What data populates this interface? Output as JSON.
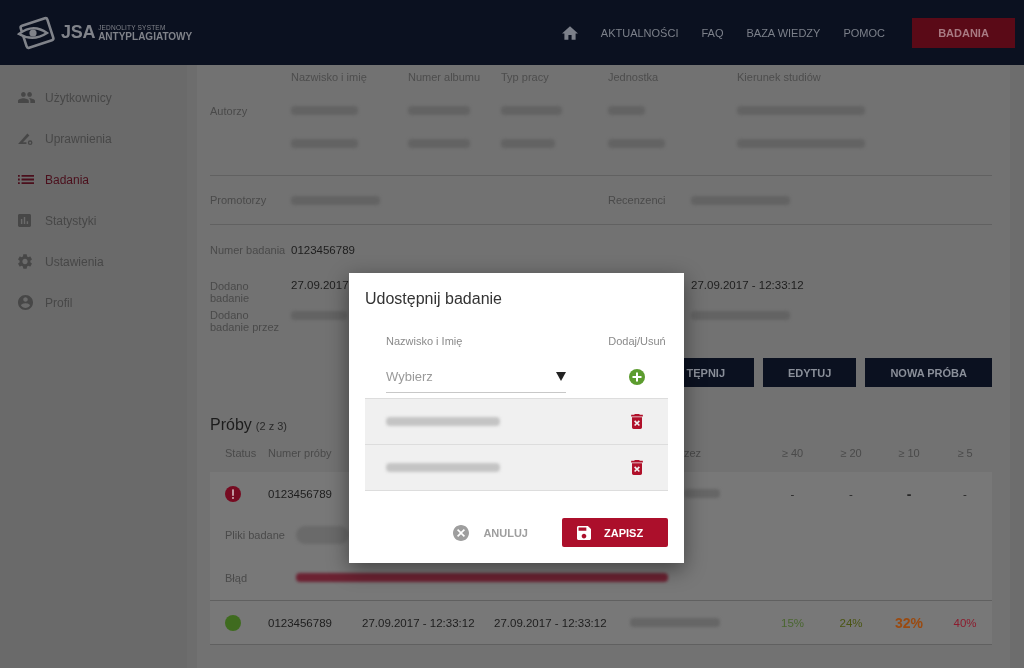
{
  "header": {
    "logo": {
      "abbr": "JSA",
      "line1": "JEDNOLITY SYSTEM",
      "line2": "ANTYPLAGIATOWY"
    },
    "nav": [
      {
        "label": "AKTUALNOŚCI"
      },
      {
        "label": "FAQ"
      },
      {
        "label": "BAZA WIEDZY"
      },
      {
        "label": "POMOC"
      }
    ],
    "action": "BADANIA"
  },
  "sidebar": {
    "items": [
      {
        "label": "Użytkownicy",
        "selected": false
      },
      {
        "label": "Uprawnienia",
        "selected": false
      },
      {
        "label": "Badania",
        "selected": true
      },
      {
        "label": "Statystyki",
        "selected": false
      },
      {
        "label": "Ustawienia",
        "selected": false
      },
      {
        "label": "Profil",
        "selected": false
      }
    ]
  },
  "authors": {
    "label": "Autorzy",
    "columns": [
      "Nazwisko i imię",
      "Numer albumu",
      "Typ pracy",
      "Jednostka",
      "Kierunek studiów"
    ],
    "rows": [
      {
        "redacted": true
      },
      {
        "redacted": true
      }
    ]
  },
  "people": [
    {
      "label": "Promotorzy",
      "redacted": true
    },
    {
      "label": "Recenzenci",
      "redacted": true
    }
  ],
  "details": [
    {
      "label": "Numer badania",
      "value": "0123456789"
    },
    {
      "label": "Dodano badanie",
      "value": "27.09.2017",
      "right_value": "27.09.2017 - 12:33:12"
    },
    {
      "label": "Dodano badanie przez",
      "redacted": true,
      "right_redacted": true
    }
  ],
  "actions": [
    "TĘPNIJ",
    "EDYTUJ",
    "NOWA PRÓBA"
  ],
  "tries": {
    "title": "Próby",
    "count": "(2 z 3)",
    "columns": [
      "Status",
      "Numer próby",
      "zez",
      "≥ 40",
      "≥ 20",
      "≥ 10",
      "≥ 5"
    ],
    "rows": [
      {
        "kind": "error",
        "number": "0123456789",
        "column_5": {
          "redacted": true,
          "partial": true
        },
        "scores": [
          {
            "text": "-",
            "emphasized": false
          },
          {
            "text": "-",
            "emphasized": false
          },
          {
            "text": "-",
            "emphasized": true
          },
          {
            "text": "-",
            "emphasized": false
          }
        ],
        "expanded": true,
        "files": {
          "label": "Pliki badane",
          "redacted": true
        },
        "error": {
          "label": "Błąd",
          "redacted": true
        }
      },
      {
        "kind": "ok",
        "number": "0123456789",
        "column_3": "27.09.2017 - 12:33:12",
        "column_4": "27.09.2017 - 12:33:12",
        "column_5": {
          "redacted": true,
          "partial": false
        },
        "scores": [
          {
            "text": "15%",
            "color": "#4a6630",
            "emphasized": false
          },
          {
            "text": "24%",
            "color": "#4a5512",
            "emphasized": false
          },
          {
            "text": "32%",
            "color": "#9a4a10",
            "emphasized": true
          },
          {
            "text": "40%",
            "color": "#8c1c2e",
            "emphasized": false
          }
        ],
        "expanded": false
      }
    ]
  },
  "dialog": {
    "title": "Udostępnij badanie",
    "columns": [
      "Nazwisko i Imię",
      "Dodaj/Usuń"
    ],
    "select": {
      "placeholder": "Wybierz"
    },
    "shared": [
      {
        "redacted": true
      },
      {
        "redacted": true
      }
    ],
    "cancel": "ANULUJ",
    "save": "ZAPISZ"
  }
}
